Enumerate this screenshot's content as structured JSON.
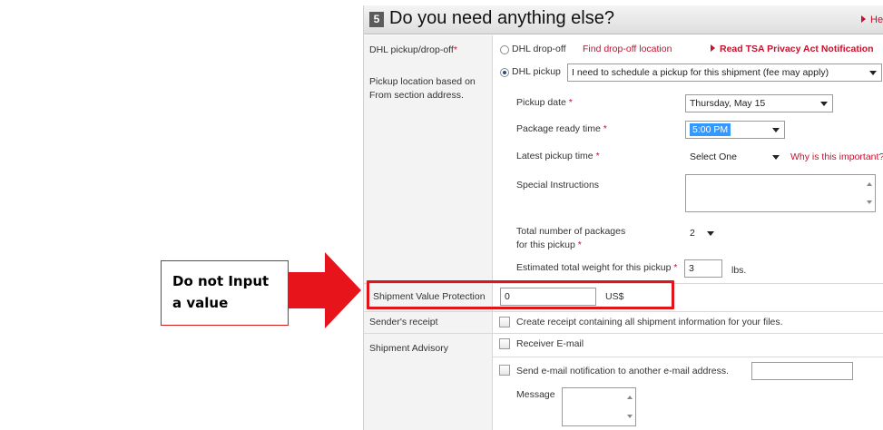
{
  "callout": {
    "line1": "Do not Input",
    "line2": "a value"
  },
  "colors": {
    "accent": "#c8102e",
    "highlight": "#e0141b",
    "arrow": "#e8141b"
  },
  "header": {
    "step": "5",
    "title": "Do you need anything else?",
    "help": "Help"
  },
  "pickup": {
    "label": "DHL pickup/drop-off",
    "required_mark": "*",
    "note": [
      "Pickup location based on",
      "From section address."
    ],
    "dropoff_option": "DHL drop-off",
    "dropoff_link": "Find drop-off location",
    "tsa_link": "Read TSA Privacy Act Notification",
    "pickup_option": "DHL pickup",
    "pickup_select": "I need to schedule a pickup for this shipment (fee may apply)",
    "date_label": "Pickup date",
    "date_value": "Thursday, May 15",
    "ready_label": "Package ready time",
    "ready_value": "5:00 PM",
    "latest_label": "Latest pickup time",
    "latest_value": "Select One",
    "why_link": "Why is this important?",
    "special_label": "Special Instructions",
    "packages_label_1": "Total number of packages",
    "packages_label_2": "for this pickup",
    "packages_value": "2",
    "weight_label": "Estimated total weight for this pickup",
    "weight_value": "3",
    "weight_unit": "lbs."
  },
  "protection": {
    "label": "Shipment Value Protection",
    "value": "0",
    "currency": "US$"
  },
  "receipt": {
    "label": "Sender's receipt",
    "text": "Create receipt containing all shipment information for your files."
  },
  "advisory": {
    "label": "Shipment Advisory",
    "receiver": "Receiver E-mail",
    "another": "Send e-mail notification to another e-mail address.",
    "message": "Message"
  }
}
